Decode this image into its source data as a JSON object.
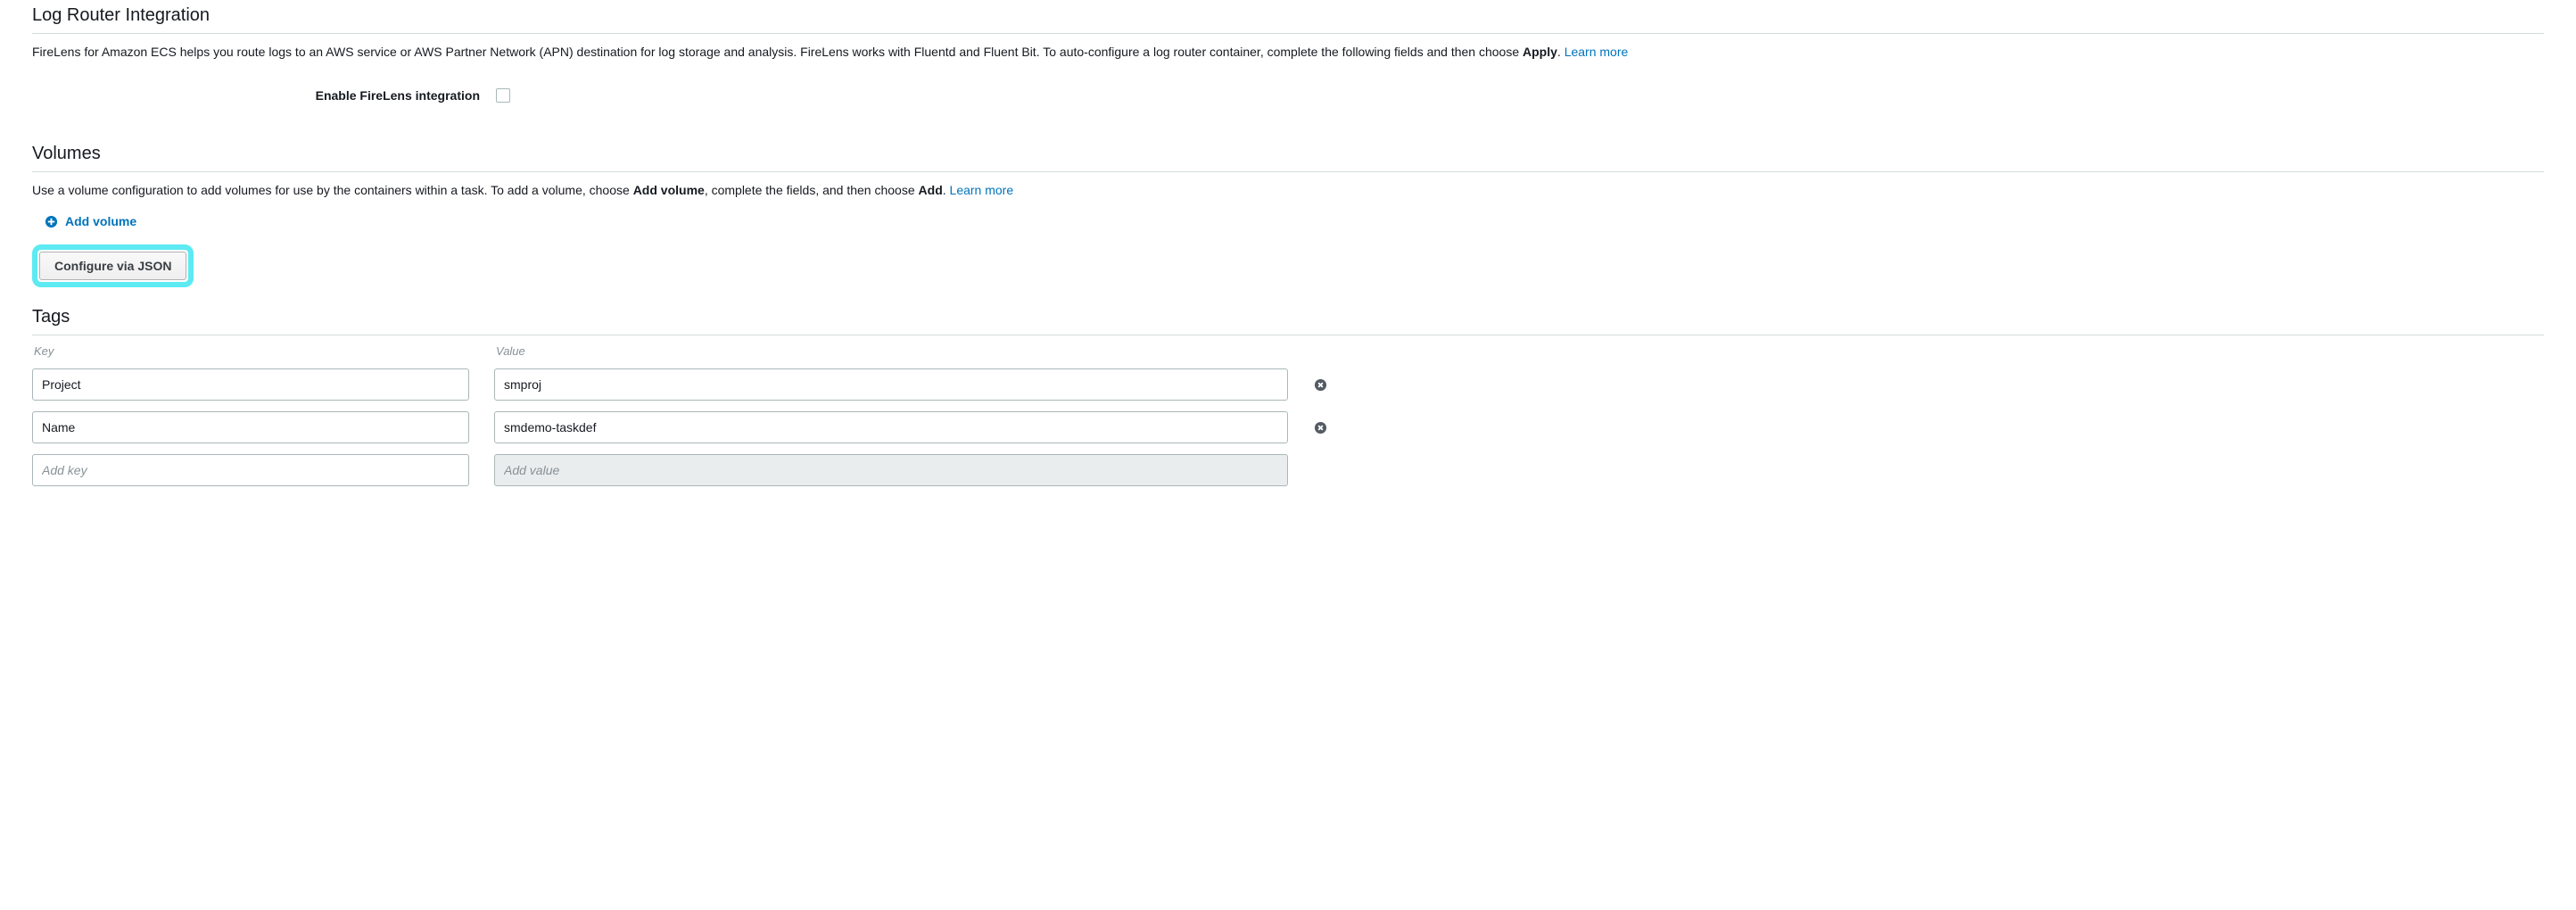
{
  "log_router": {
    "title": "Log Router Integration",
    "desc_part1": "FireLens for Amazon ECS helps you route logs to an AWS service or AWS Partner Network (APN) destination for log storage and analysis. FireLens works with Fluentd and Fluent Bit. To auto-configure a log router container, complete the following fields and then choose ",
    "desc_bold": "Apply",
    "desc_part2": ". ",
    "learn_more": "Learn more",
    "enable_label": "Enable FireLens integration",
    "enabled": false
  },
  "volumes": {
    "title": "Volumes",
    "desc_part1": "Use a volume configuration to add volumes for use by the containers within a task. To add a volume, choose ",
    "desc_bold1": "Add volume",
    "desc_part2": ", complete the fields, and then choose ",
    "desc_bold2": "Add",
    "desc_part3": ". ",
    "learn_more": "Learn more",
    "add_volume_label": "Add volume",
    "configure_json_label": "Configure via JSON"
  },
  "tags": {
    "title": "Tags",
    "key_header": "Key",
    "value_header": "Value",
    "rows": [
      {
        "key": "Project",
        "value": "smproj"
      },
      {
        "key": "Name",
        "value": "smdemo-taskdef"
      }
    ],
    "add_key_placeholder": "Add key",
    "add_value_placeholder": "Add value"
  }
}
